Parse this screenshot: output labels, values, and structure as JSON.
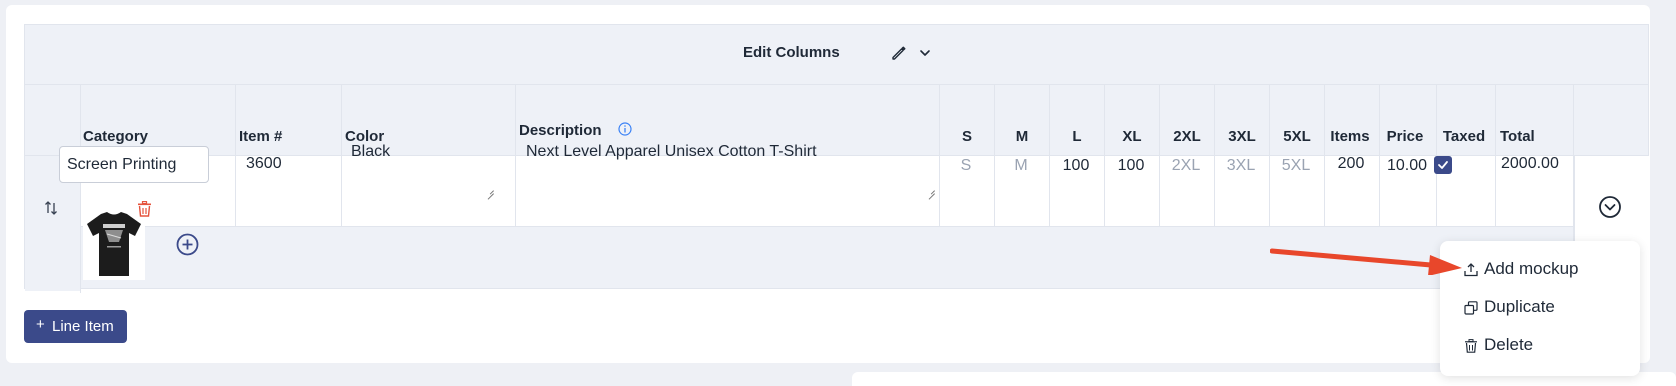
{
  "toolbar": {
    "edit_columns_label": "Edit Columns"
  },
  "columns": {
    "category": "Category",
    "item_no": "Item #",
    "color": "Color",
    "description": "Description",
    "s": "S",
    "m": "M",
    "l": "L",
    "xl": "XL",
    "xxl": "2XL",
    "xxxl": "3XL",
    "xxxxxl": "5XL",
    "items": "Items",
    "price": "Price",
    "taxed": "Taxed",
    "total": "Total"
  },
  "line_item": {
    "category": "Screen Printing",
    "item_no": "3600",
    "color": "Black",
    "description": "Next Level Apparel Unisex Cotton T-Shirt",
    "s_placeholder": "S",
    "m_placeholder": "M",
    "l": "100",
    "xl": "100",
    "xxl_placeholder": "2XL",
    "xxxl_placeholder": "3XL",
    "xxxxxl_placeholder": "5XL",
    "items": "200",
    "price": "10.00",
    "taxed": true,
    "total": "2000.00"
  },
  "actions": {
    "add_line_item_label": "Line Item",
    "add_line_item_plus": "+"
  },
  "menu": {
    "items": [
      {
        "label": "Add mockup",
        "icon": "upload-icon"
      },
      {
        "label": "Duplicate",
        "icon": "copy-icon"
      },
      {
        "label": "Delete",
        "icon": "trash-icon"
      }
    ]
  },
  "colors": {
    "accent": "#3b4a8a",
    "danger": "#e5533d",
    "arrow": "#e8472b",
    "info": "#3b82f6"
  }
}
